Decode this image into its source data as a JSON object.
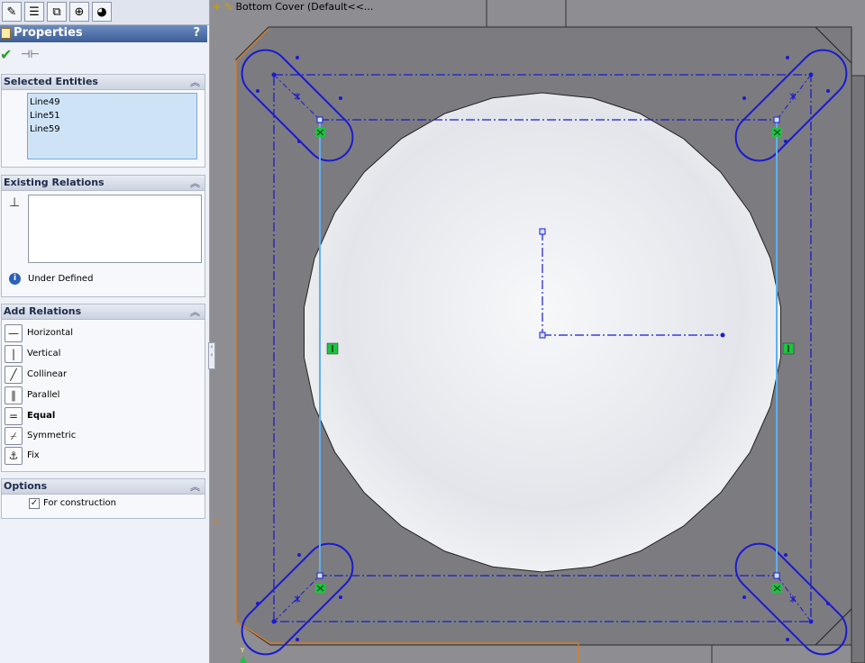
{
  "tabs": [
    {
      "name": "feature-manager-tab-icon",
      "glyph": "✎"
    },
    {
      "name": "property-manager-tab-icon",
      "glyph": "☰"
    },
    {
      "name": "configuration-manager-tab-icon",
      "glyph": "⧉"
    },
    {
      "name": "dim-xpert-tab-icon",
      "glyph": "⊕"
    },
    {
      "name": "display-manager-tab-icon",
      "glyph": "◕"
    }
  ],
  "header": {
    "title": "Properties",
    "help": "?"
  },
  "feature_tree": {
    "label": "Bottom Cover  (Default<<..."
  },
  "selected_entities": {
    "title": "Selected Entities",
    "items": [
      "Line49",
      "Line51",
      "Line59"
    ]
  },
  "existing_relations": {
    "title": "Existing Relations",
    "status": "Under Defined"
  },
  "add_relations": {
    "title": "Add Relations",
    "items": [
      {
        "label": "Horizontal",
        "glyph": "—",
        "icon": "horizontal-relation-icon"
      },
      {
        "label": "Vertical",
        "glyph": "|",
        "icon": "vertical-relation-icon"
      },
      {
        "label": "Collinear",
        "glyph": "╱",
        "icon": "collinear-relation-icon"
      },
      {
        "label": "Parallel",
        "glyph": "∥",
        "icon": "parallel-relation-icon"
      },
      {
        "label": "Equal",
        "glyph": "=",
        "icon": "equal-relation-icon"
      },
      {
        "label": "Symmetric",
        "glyph": "⌿",
        "icon": "symmetric-relation-icon"
      },
      {
        "label": "Fix",
        "glyph": "⚓",
        "icon": "fix-relation-icon"
      }
    ]
  },
  "options": {
    "title": "Options",
    "for_construction": {
      "label": "For construction",
      "checked": true
    }
  },
  "colors": {
    "sketch_blue": "#1a1ad0",
    "selected_line": "#5fb0f0",
    "relation_green": "#1fc243",
    "model_edge": "#d47c2a",
    "face": "#eaecef",
    "background": "#8e8e92"
  }
}
